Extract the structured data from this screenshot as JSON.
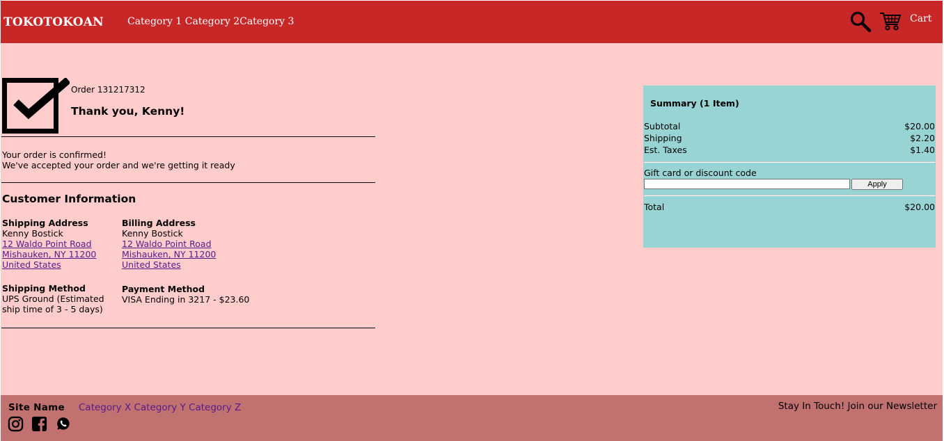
{
  "header": {
    "brand": "TOKOTOKOAN",
    "nav": [
      "Category 1",
      "Category 2",
      "Category 3"
    ],
    "search_icon": "search-icon",
    "cart_icon": "cart-icon",
    "cart_label": "Cart",
    "colors": {
      "background": "#c72727",
      "text": "#ffffff"
    }
  },
  "order": {
    "status_icon": "checkbox-check-icon",
    "number_text": "Order 131217312",
    "thank_you": "Thank you, Kenny!",
    "confirm_line1": "Your order is confirmed!",
    "confirm_line2": "We've accepted your order and we're getting it ready"
  },
  "customer": {
    "title": "Customer Information",
    "shipping_address": {
      "label": "Shipping Address",
      "name": "Kenny Bostick",
      "street": "12 Waldo Point Road",
      "city": "Mishauken, NY 11200",
      "country": "United States"
    },
    "billing_address": {
      "label": "Billing Address",
      "name": "Kenny Bostick",
      "street": "12 Waldo Point Road",
      "city": "Mishauken, NY 11200",
      "country": "United States"
    },
    "shipping_method": {
      "label": "Shipping Method",
      "line1": "UPS Ground (Estimated",
      "line2": "ship time of 3 - 5 days)"
    },
    "payment_method": {
      "label": "Payment Method",
      "value": "VISA Ending in 3217 - $23.60"
    }
  },
  "summary": {
    "title": "Summary (1 Item)",
    "rows": [
      {
        "label": "Subtotal",
        "value": "$20.00"
      },
      {
        "label": "Shipping",
        "value": "$2.20"
      },
      {
        "label": "Est. Taxes",
        "value": "$1.40"
      }
    ],
    "gift_label": "Gift card or discount code",
    "gift_value": "",
    "gift_placeholder": "",
    "apply_label": "Apply",
    "total_label": "Total",
    "total_value": "$20.00",
    "background": "#98d4d4"
  },
  "footer": {
    "site_name": "Site Name",
    "nav": [
      "Category X",
      "Category Y",
      "Category Z"
    ],
    "newsletter": "Stay In Touch! Join our Newsletter",
    "social_icons": [
      "instagram-icon",
      "facebook-icon",
      "whatsapp-icon"
    ],
    "background": "#c27171",
    "link_color": "#551a8b"
  },
  "page": {
    "background": "#ffcccc"
  }
}
